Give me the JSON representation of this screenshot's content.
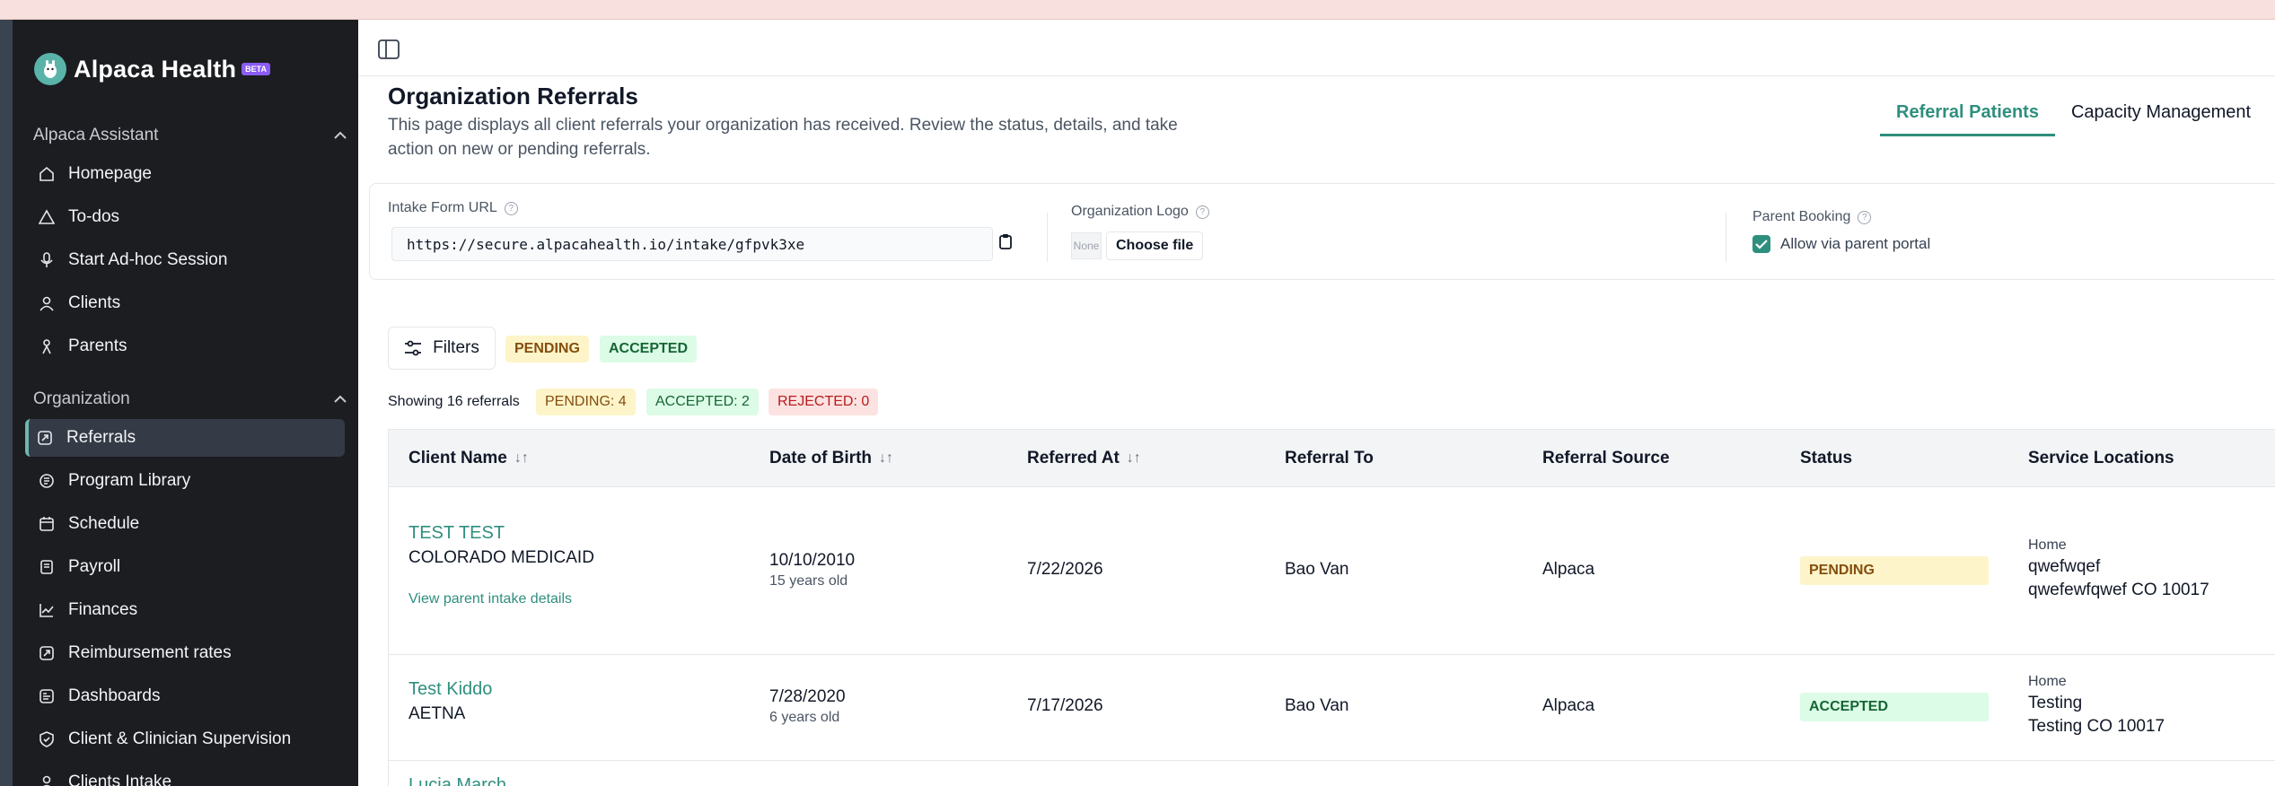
{
  "app": {
    "name": "Alpaca Health",
    "badge": "BETA"
  },
  "sidebar": {
    "sections": [
      {
        "title": "Alpaca Assistant",
        "items": [
          {
            "label": "Homepage",
            "icon": "home-icon"
          },
          {
            "label": "To-dos",
            "icon": "alert-triangle-icon"
          },
          {
            "label": "Start Ad-hoc Session",
            "icon": "microphone-icon"
          },
          {
            "label": "Clients",
            "icon": "users-icon"
          },
          {
            "label": "Parents",
            "icon": "person-icon"
          }
        ]
      },
      {
        "title": "Organization",
        "items": [
          {
            "label": "Referrals",
            "icon": "referral-icon",
            "active": true
          },
          {
            "label": "Program Library",
            "icon": "library-icon"
          },
          {
            "label": "Schedule",
            "icon": "calendar-icon"
          },
          {
            "label": "Payroll",
            "icon": "payroll-icon"
          },
          {
            "label": "Finances",
            "icon": "chart-line-icon"
          },
          {
            "label": "Reimbursement rates",
            "icon": "receipt-icon"
          },
          {
            "label": "Dashboards",
            "icon": "dashboard-icon"
          },
          {
            "label": "Client & Clinician Supervision",
            "icon": "shield-icon"
          },
          {
            "label": "Clients Intake",
            "icon": "intake-icon"
          }
        ]
      }
    ]
  },
  "page": {
    "title": "Organization Referrals",
    "description": "This page displays all client referrals your organization has received. Review the status, details, and take action on new or pending referrals."
  },
  "tabs": [
    {
      "label": "Referral Patients",
      "active": true
    },
    {
      "label": "Capacity Management",
      "active": false
    }
  ],
  "settings": {
    "intake_label": "Intake Form URL",
    "intake_url": "https://secure.alpacahealth.io/intake/gfpvk3xe",
    "logo_label": "Organization Logo",
    "logo_placeholder": "None",
    "choose_file": "Choose file",
    "parent_booking_label": "Parent Booking",
    "parent_booking_option": "Allow via parent portal",
    "parent_booking_checked": true
  },
  "filters": {
    "button_label": "Filters",
    "active_chips": [
      "PENDING",
      "ACCEPTED"
    ]
  },
  "summary": {
    "showing": "Showing 16 referrals",
    "pending": "PENDING: 4",
    "accepted": "ACCEPTED: 2",
    "rejected": "REJECTED: 0"
  },
  "table": {
    "columns": [
      "Client Name",
      "Date of Birth",
      "Referred At",
      "Referral To",
      "Referral Source",
      "Status",
      "Service Locations"
    ],
    "sort_icons": {
      "Client Name": "↓↑",
      "Date of Birth": "↓↑",
      "Referred At": "↓↑"
    },
    "rows": [
      {
        "client_name": "TEST TEST",
        "insurance": "COLORADO MEDICAID",
        "extra_link": "View parent intake details",
        "dob": "10/10/2010",
        "age": "15 years old",
        "referred_at": "7/22/2026",
        "referral_to": "Bao Van",
        "referral_source": "Alpaca",
        "status": "PENDING",
        "location_type": "Home",
        "location_line1": "qwefwqef",
        "location_line2": "qwefewfqwef CO 10017"
      },
      {
        "client_name": "Test Kiddo",
        "insurance": "AETNA",
        "dob": "7/28/2020",
        "age": "6 years old",
        "referred_at": "7/17/2026",
        "referral_to": "Bao Van",
        "referral_source": "Alpaca",
        "status": "ACCEPTED",
        "location_type": "Home",
        "location_line1": "Testing",
        "location_line2": "Testing CO 10017"
      },
      {
        "client_name": "Lucia March"
      }
    ]
  },
  "colors": {
    "accent": "#2f8f7e",
    "sidebar_bg": "#1c1d21",
    "pending_bg": "#fdf5c9",
    "accepted_bg": "#dcfce7",
    "rejected_bg": "#fde2e2"
  }
}
